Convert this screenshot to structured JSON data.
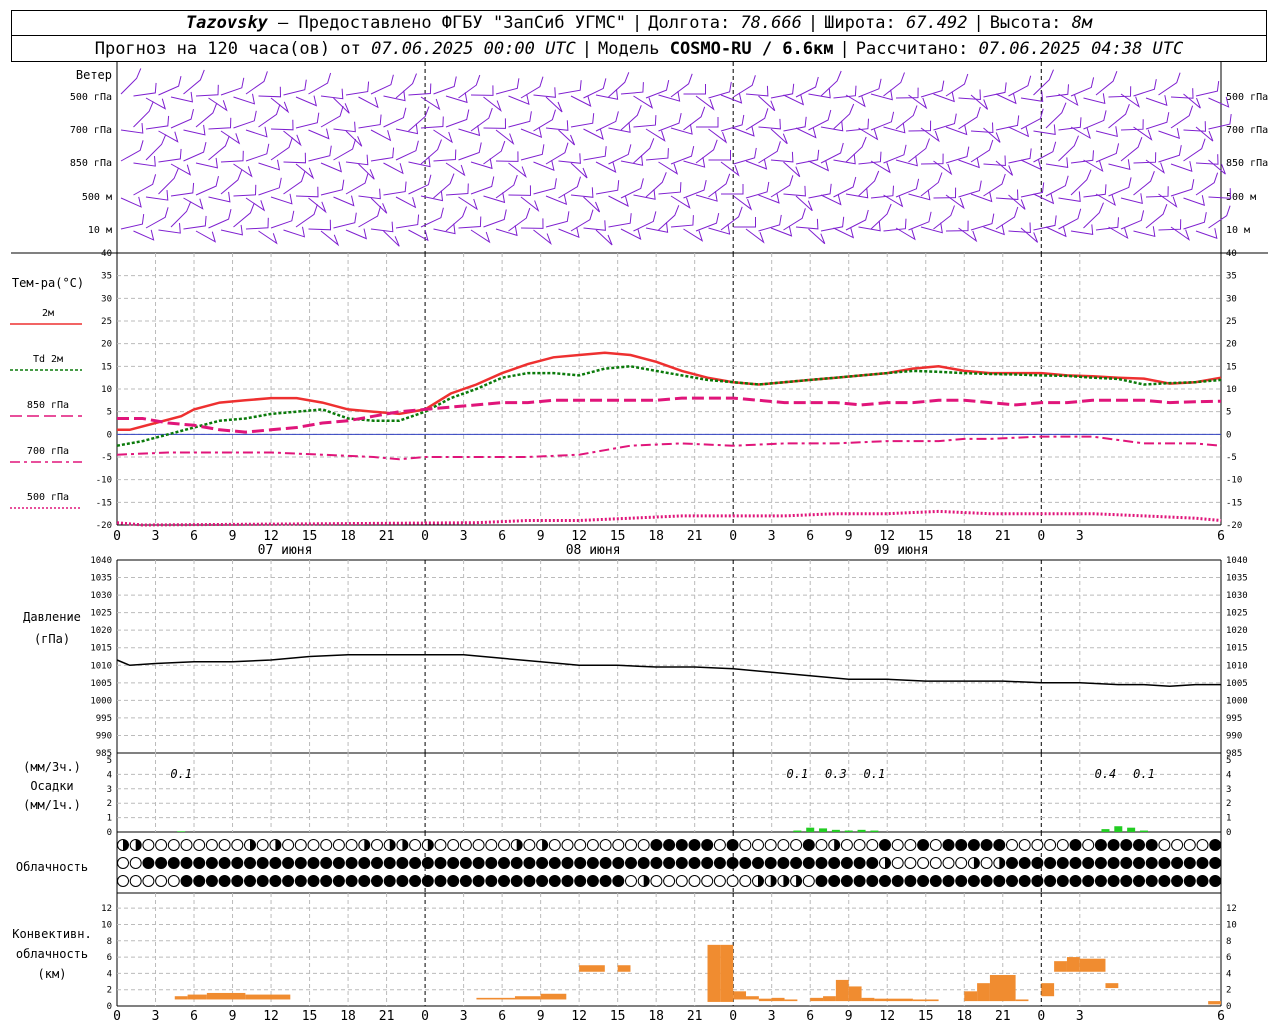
{
  "header": {
    "station": "Tazovsky",
    "provider": "– Предоставлено ФГБУ \"ЗапСиб УГМС\"",
    "lon_label": "Долгота:",
    "lon": "78.666",
    "lat_label": "Широта:",
    "lat": "67.492",
    "alt_label": "Высота:",
    "alt": "8м",
    "forecast_text": "Прогноз на 120 часа(ов) от",
    "run_time": "07.06.2025 00:00 UTC",
    "model_label": "Модель",
    "model": "COSMO-RU / 6.6км",
    "calc_label": "Рассчитано:",
    "calc_time": "07.06.2025 04:38 UTC"
  },
  "x_axis": {
    "hour_labels": [
      "0",
      "3",
      "6",
      "9",
      "12",
      "15",
      "18",
      "21",
      "0",
      "3",
      "6",
      "9",
      "12",
      "15",
      "18",
      "21",
      "0",
      "3",
      "6",
      "9",
      "12",
      "15",
      "18",
      "21",
      "0",
      "3",
      "6"
    ],
    "day_labels": [
      "07 июня",
      "08 июня",
      "09 июня"
    ]
  },
  "wind_panel": {
    "title": "Ветер",
    "levels": [
      "500 гПа",
      "700 гПа",
      "850 гПа",
      "500 м",
      "10  м"
    ],
    "barb_color": "#7f20d0"
  },
  "temp_panel": {
    "title": "Тем-ра(°C)",
    "legend": [
      {
        "label": "2м",
        "color": "#ee3030",
        "style": "solid"
      },
      {
        "label": "Td  2м",
        "color": "#0a7a0a",
        "style": "dotted"
      },
      {
        "label": "850 гПа",
        "color": "#e0157a",
        "style": "longdash"
      },
      {
        "label": "700 гПа",
        "color": "#e0157a",
        "style": "dashdot"
      },
      {
        "label": "500 гПа",
        "color": "#e0157a",
        "style": "dots"
      }
    ],
    "yticks": [
      "40",
      "35",
      "30",
      "25",
      "20",
      "15",
      "10",
      "5",
      "0",
      "-5",
      "-10",
      "-15",
      "-20"
    ]
  },
  "pressure_panel": {
    "title": "Давление",
    "unit": "(гПа)",
    "yticks": [
      "1040",
      "1035",
      "1030",
      "1025",
      "1020",
      "1015",
      "1010",
      "1005",
      "1000",
      "995",
      "990",
      "985"
    ]
  },
  "precip_panel": {
    "unit1": "(мм/3ч.)",
    "title": "Осадки",
    "unit2": "(мм/1ч.)",
    "yticks": [
      "5",
      "4",
      "3",
      "2",
      "1",
      "0"
    ],
    "amounts": [
      {
        "hour": 5,
        "text": "0.1"
      },
      {
        "hour": 53,
        "text": "0.1"
      },
      {
        "hour": 56,
        "text": "0.3"
      },
      {
        "hour": 59,
        "text": "0.1"
      },
      {
        "hour": 77,
        "text": "0.4"
      },
      {
        "hour": 80,
        "text": "0.1"
      }
    ]
  },
  "cloud_panel": {
    "title": "Облачность"
  },
  "conv_panel": {
    "title1": "Конвективн.",
    "title2": "облачность",
    "unit": "(км)",
    "yticks": [
      "12",
      "10",
      "8",
      "6",
      "4",
      "2",
      "0"
    ],
    "bar_color": "#f08c30"
  },
  "chart_data": [
    {
      "type": "line",
      "title": "Тем-ра(°C)",
      "x_unit": "hours since 07.06.2025 00:00 UTC",
      "ylim": [
        -20,
        40
      ],
      "grid": true,
      "series": [
        {
          "name": "2м",
          "x": [
            0,
            1,
            3,
            5,
            6,
            8,
            10,
            12,
            14,
            16,
            18,
            20,
            22,
            24,
            26,
            28,
            30,
            32,
            34,
            36,
            38,
            40,
            42,
            44,
            46,
            48,
            50,
            52,
            54,
            56,
            58,
            60,
            62,
            64,
            66,
            68,
            70,
            72,
            74,
            76,
            78,
            80,
            82,
            84,
            86
          ],
          "y": [
            1.0,
            1.0,
            2.5,
            4.0,
            5.5,
            7.0,
            7.5,
            8.0,
            8.0,
            7.0,
            5.5,
            5.0,
            4.5,
            5.5,
            9,
            11,
            13.5,
            15.5,
            17,
            17.5,
            18,
            17.5,
            16,
            14,
            12.5,
            11.5,
            11,
            11.5,
            12,
            12.5,
            13,
            13.5,
            14.5,
            15,
            14,
            13.5,
            13.5,
            13.5,
            13,
            12.8,
            12.5,
            12.3,
            11.2,
            11.5,
            12.5
          ]
        },
        {
          "name": "Td  2м",
          "x": [
            0,
            2,
            4,
            6,
            8,
            10,
            12,
            14,
            16,
            18,
            20,
            22,
            24,
            26,
            28,
            30,
            32,
            34,
            36,
            38,
            40,
            42,
            44,
            46,
            48,
            50,
            52,
            54,
            56,
            58,
            60,
            62,
            64,
            66,
            68,
            70,
            72,
            74,
            76,
            78,
            80,
            82,
            84,
            86
          ],
          "y": [
            -2.5,
            -1.5,
            0,
            1.5,
            3,
            3.5,
            4.5,
            5,
            5.5,
            3.5,
            3,
            3,
            5,
            8,
            10,
            12.5,
            13.5,
            13.5,
            13,
            14.5,
            15,
            14,
            13,
            12,
            11.5,
            11,
            11.5,
            12,
            12.5,
            13,
            13.5,
            14,
            13.8,
            13.5,
            13.3,
            13.2,
            13,
            12.9,
            12.5,
            12.2,
            11.0,
            11.3,
            11.5,
            12.0
          ]
        },
        {
          "name": "850 гПа",
          "x": [
            0,
            2,
            4,
            6,
            8,
            10,
            12,
            14,
            16,
            18,
            20,
            22,
            24,
            26,
            28,
            30,
            32,
            34,
            36,
            38,
            40,
            42,
            44,
            46,
            48,
            50,
            52,
            54,
            56,
            58,
            60,
            62,
            64,
            66,
            68,
            70,
            72,
            74,
            76,
            78,
            80,
            82,
            84,
            86
          ],
          "y": [
            3.5,
            3.5,
            2.5,
            2,
            1,
            0.5,
            1,
            1.5,
            2.5,
            3,
            4,
            5,
            5.5,
            6,
            6.5,
            7,
            7,
            7.5,
            7.5,
            7.5,
            7.5,
            7.5,
            8,
            8,
            8,
            7.5,
            7,
            7,
            7,
            6.5,
            7,
            7,
            7.5,
            7.5,
            7,
            6.5,
            7,
            7,
            7.5,
            7.5,
            7.5,
            7,
            7.2,
            7.3
          ]
        },
        {
          "name": "700 гПа",
          "x": [
            0,
            4,
            8,
            12,
            16,
            20,
            22,
            24,
            28,
            32,
            36,
            38,
            40,
            44,
            48,
            52,
            56,
            60,
            64,
            66,
            68,
            72,
            76,
            80,
            84,
            86
          ],
          "y": [
            -4.5,
            -4,
            -4,
            -4,
            -4.5,
            -5,
            -5.5,
            -5,
            -5,
            -5,
            -4.5,
            -3.5,
            -2.5,
            -2,
            -2.5,
            -2,
            -2,
            -1.5,
            -1.5,
            -1,
            -1,
            -0.5,
            -0.5,
            -2,
            -2,
            -2.5
          ]
        },
        {
          "name": "500 гПа",
          "x": [
            0,
            2,
            28,
            32,
            36,
            40,
            44,
            48,
            52,
            56,
            60,
            64,
            68,
            72,
            76,
            80,
            84,
            86
          ],
          "y": [
            -19.5,
            -20,
            -19.5,
            -19,
            -19,
            -18.5,
            -18,
            -18,
            -18,
            -17.5,
            -17.5,
            -17,
            -17.5,
            -17.5,
            -17.5,
            -18,
            -18.5,
            -19
          ]
        }
      ]
    },
    {
      "type": "line",
      "title": "Давление",
      "x_unit": "hours since 07.06.2025 00:00 UTC",
      "ylim": [
        985,
        1040
      ],
      "grid": true,
      "series": [
        {
          "x": [
            0,
            1,
            3,
            6,
            9,
            12,
            15,
            18,
            21,
            24,
            27,
            30,
            33,
            36,
            39,
            42,
            45,
            48,
            51,
            54,
            57,
            60,
            63,
            66,
            69,
            72,
            75,
            78,
            80,
            82,
            84,
            86
          ],
          "y": [
            1011.5,
            1010,
            1010.5,
            1011,
            1011,
            1011.5,
            1012.5,
            1013,
            1013,
            1013,
            1013,
            1012,
            1011,
            1010,
            1010,
            1009.5,
            1009.5,
            1009,
            1008,
            1007,
            1006,
            1006,
            1005.5,
            1005.5,
            1005.5,
            1005,
            1005,
            1004.5,
            1004.5,
            1004,
            1004.5,
            1004.5
          ]
        }
      ]
    },
    {
      "type": "bar",
      "title": "Осадки",
      "x_unit": "hours since 07.06.2025 00:00 UTC",
      "ylim": [
        0,
        5
      ],
      "x": [
        5,
        53,
        54,
        55,
        56,
        57,
        58,
        59,
        77,
        78,
        79,
        80
      ],
      "values": [
        0.05,
        0.1,
        0.3,
        0.25,
        0.15,
        0.1,
        0.15,
        0.1,
        0.2,
        0.4,
        0.3,
        0.1
      ]
    },
    {
      "type": "bar",
      "title": "Конвективн. облачность",
      "x_unit": "hours since 07.06.2025 00:00 UTC",
      "ylim": [
        0,
        13
      ],
      "bars": [
        {
          "x0": 4.5,
          "x1": 5.5,
          "lo": 0.8,
          "hi": 1.2
        },
        {
          "x0": 5.5,
          "x1": 7,
          "lo": 0.8,
          "hi": 1.4
        },
        {
          "x0": 7,
          "x1": 10,
          "lo": 0.8,
          "hi": 1.6
        },
        {
          "x0": 10,
          "x1": 13.5,
          "lo": 0.8,
          "hi": 1.4
        },
        {
          "x0": 28,
          "x1": 31,
          "lo": 0.8,
          "hi": 1.0
        },
        {
          "x0": 31,
          "x1": 33,
          "lo": 0.8,
          "hi": 1.2
        },
        {
          "x0": 33,
          "x1": 35,
          "lo": 0.8,
          "hi": 1.5
        },
        {
          "x0": 36,
          "x1": 38,
          "lo": 4.2,
          "hi": 5.0
        },
        {
          "x0": 39,
          "x1": 40,
          "lo": 4.2,
          "hi": 5.0
        },
        {
          "x0": 46,
          "x1": 47,
          "lo": 0.5,
          "hi": 7.5
        },
        {
          "x0": 47,
          "x1": 48,
          "lo": 0.5,
          "hi": 7.5
        },
        {
          "x0": 48,
          "x1": 49,
          "lo": 0.8,
          "hi": 1.8
        },
        {
          "x0": 49,
          "x1": 50,
          "lo": 0.8,
          "hi": 1.2
        },
        {
          "x0": 50,
          "x1": 51,
          "lo": 0.6,
          "hi": 0.9
        },
        {
          "x0": 51,
          "x1": 52,
          "lo": 0.6,
          "hi": 1.0
        },
        {
          "x0": 52,
          "x1": 53,
          "lo": 0.6,
          "hi": 0.8
        },
        {
          "x0": 54,
          "x1": 55,
          "lo": 0.6,
          "hi": 1.0
        },
        {
          "x0": 55,
          "x1": 56,
          "lo": 0.6,
          "hi": 1.2
        },
        {
          "x0": 56,
          "x1": 57,
          "lo": 0.6,
          "hi": 3.2
        },
        {
          "x0": 57,
          "x1": 58,
          "lo": 0.6,
          "hi": 2.4
        },
        {
          "x0": 58,
          "x1": 59,
          "lo": 0.6,
          "hi": 1.0
        },
        {
          "x0": 59,
          "x1": 62,
          "lo": 0.6,
          "hi": 0.9
        },
        {
          "x0": 62,
          "x1": 64,
          "lo": 0.6,
          "hi": 0.8
        },
        {
          "x0": 66,
          "x1": 67,
          "lo": 0.6,
          "hi": 1.8
        },
        {
          "x0": 67,
          "x1": 68,
          "lo": 0.6,
          "hi": 2.8
        },
        {
          "x0": 68,
          "x1": 70,
          "lo": 0.6,
          "hi": 3.8
        },
        {
          "x0": 70,
          "x1": 71,
          "lo": 0.6,
          "hi": 0.8
        },
        {
          "x0": 72,
          "x1": 73,
          "lo": 1.2,
          "hi": 2.8
        },
        {
          "x0": 73,
          "x1": 74,
          "lo": 4.2,
          "hi": 5.5
        },
        {
          "x0": 74,
          "x1": 75,
          "lo": 4.2,
          "hi": 6.0
        },
        {
          "x0": 75,
          "x1": 77,
          "lo": 4.2,
          "hi": 5.8
        },
        {
          "x0": 77,
          "x1": 78,
          "lo": 2.2,
          "hi": 2.8
        },
        {
          "x0": 85,
          "x1": 86,
          "lo": 0.2,
          "hi": 0.6
        }
      ]
    }
  ]
}
